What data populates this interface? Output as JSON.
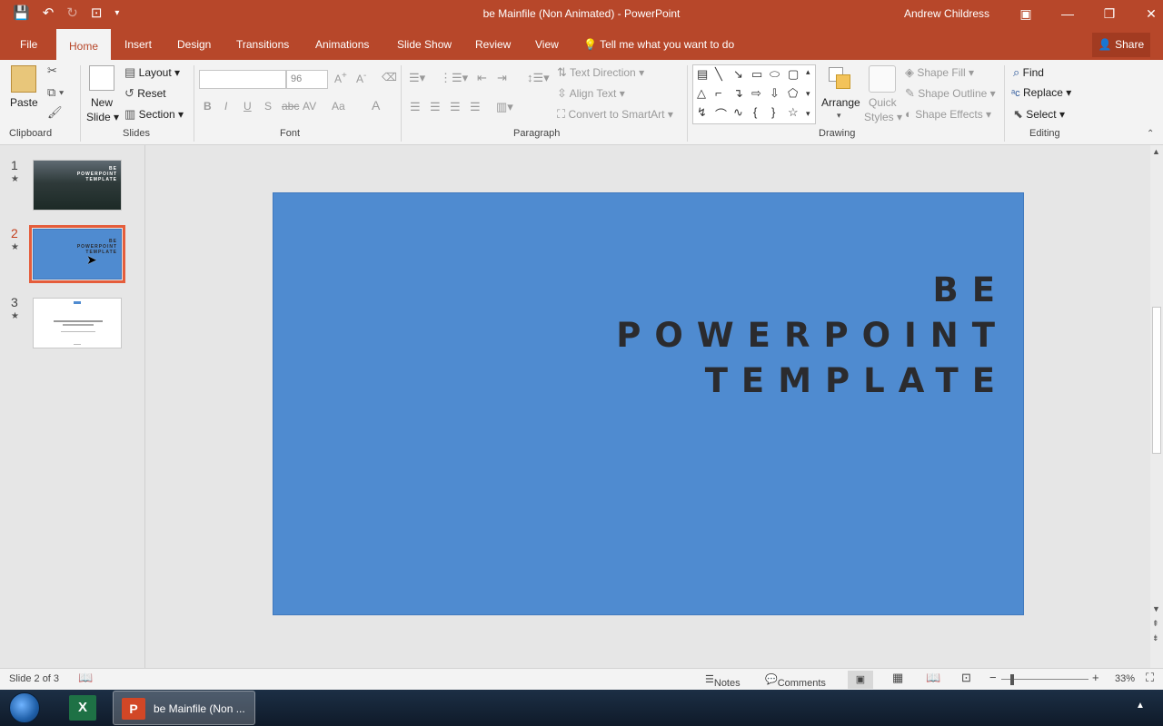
{
  "window": {
    "title": "be Mainfile (Non Animated)  -  PowerPoint",
    "user": "Andrew Childress",
    "share": "Share"
  },
  "qat": {
    "save": "💾",
    "undo": "↶",
    "redo": "↻",
    "present": "⊡",
    "more": "▾"
  },
  "tabs": [
    "File",
    "Home",
    "Insert",
    "Design",
    "Transitions",
    "Animations",
    "Slide Show",
    "Review",
    "View"
  ],
  "tell": "Tell me what you want to do",
  "ribbon": {
    "clipboard": {
      "label": "Clipboard",
      "paste": "Paste"
    },
    "slides": {
      "label": "Slides",
      "new_slide": "New",
      "new_slide2": "Slide",
      "layout": "Layout",
      "reset": "Reset",
      "section": "Section"
    },
    "font": {
      "label": "Font",
      "size": "96",
      "bold": "B",
      "italic": "I",
      "underline": "U",
      "shadow": "S",
      "strike": "abc",
      "spacing": "AV",
      "case": "Aa",
      "color": "A"
    },
    "paragraph": {
      "label": "Paragraph",
      "text_direction": "Text Direction",
      "align_text": "Align Text",
      "convert": "Convert to SmartArt"
    },
    "drawing": {
      "label": "Drawing",
      "arrange": "Arrange",
      "quick": "Quick",
      "styles": "Styles",
      "shape_fill": "Shape Fill",
      "shape_outline": "Shape Outline",
      "shape_effects": "Shape Effects"
    },
    "editing": {
      "label": "Editing",
      "find": "Find",
      "replace": "Replace",
      "select": "Select"
    }
  },
  "slides_panel": [
    {
      "num": "1",
      "star": "★"
    },
    {
      "num": "2",
      "star": "★"
    },
    {
      "num": "3",
      "star": "★"
    }
  ],
  "slide": {
    "line1": "BE",
    "line2": "POWERPOINT",
    "line3": "TEMPLATE",
    "bg": "#4f8bd0"
  },
  "thumb1": {
    "l1": "BE",
    "l2": "POWERPOINT",
    "l3": "TEMPLATE"
  },
  "status": {
    "slide_info": "Slide 2 of 3",
    "notes": "Notes",
    "comments": "Comments",
    "zoom": "33%"
  },
  "taskbar": {
    "ppt_label": "be Mainfile (Non ..."
  }
}
